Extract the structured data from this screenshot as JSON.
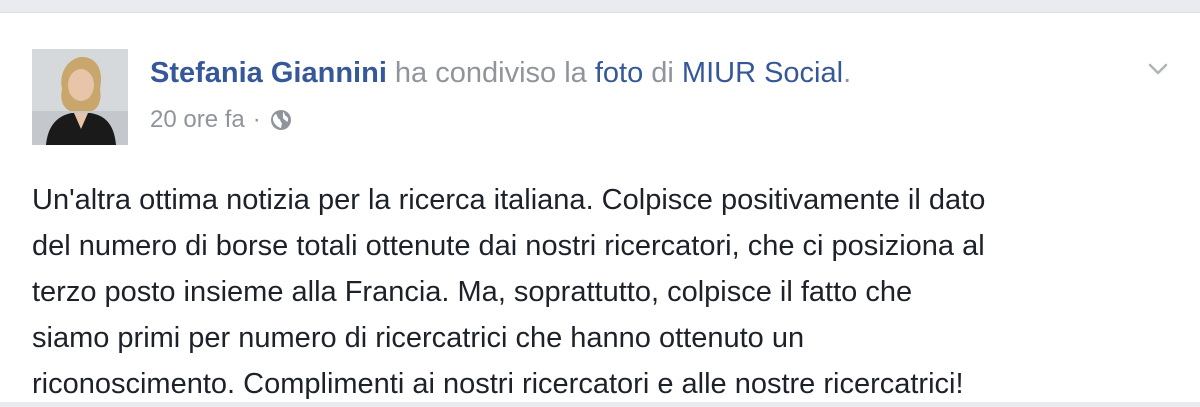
{
  "post": {
    "author": "Stefania Giannini",
    "shared_text_1": " ha condiviso la ",
    "shared_link": "foto",
    "shared_text_2": " di ",
    "page_name": "MIUR Social",
    "shared_text_3": ".",
    "timestamp": "20 ore fa",
    "separator": "·",
    "privacy_icon": "globe-icon",
    "menu_icon": "chevron-down-icon",
    "body_lines": [
      "Un'altra ottima notizia per la ricerca italiana. Colpisce positivamente il dato",
      "del numero di borse totali ottenute dai nostri ricercatori, che ci posiziona al",
      "terzo posto insieme alla Francia. Ma, soprattutto, colpisce il fatto che",
      "siamo primi per numero di ricercatrici che hanno ottenuto un",
      "riconoscimento. Complimenti ai nostri ricercatori e alle nostre ricercatrici!"
    ]
  },
  "colors": {
    "link": "#365899",
    "meta": "#90949c",
    "text": "#1d2129"
  }
}
